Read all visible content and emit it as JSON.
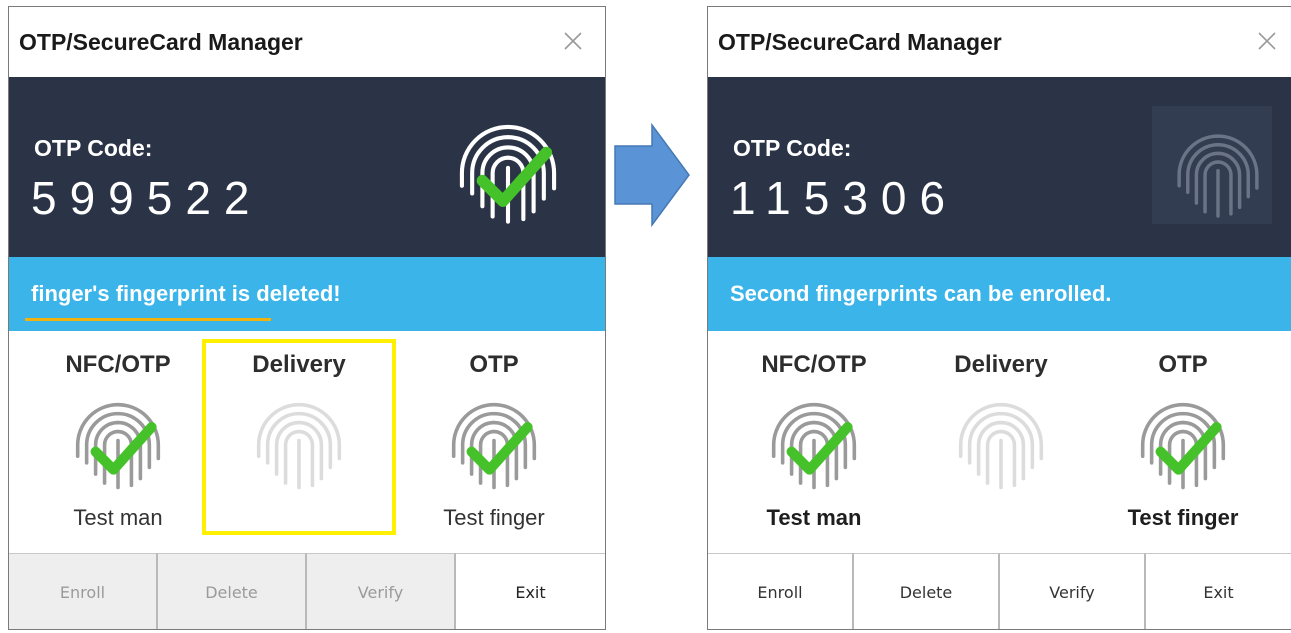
{
  "left_window": {
    "title": "OTP/SecureCard Manager",
    "otp_label": "OTP Code:",
    "otp_code": "599522",
    "status_message": "finger's fingerprint is deleted!",
    "slots": [
      {
        "title": "NFC/OTP",
        "user": "Test man",
        "state": "enrolled-check-icon"
      },
      {
        "title": "Delivery",
        "user": "",
        "state": "empty-fingerprint-icon"
      },
      {
        "title": "OTP",
        "user": "Test finger",
        "state": "enrolled-check-icon"
      }
    ],
    "buttons": {
      "enroll": "Enroll",
      "delete": "Delete",
      "verify": "Verify",
      "exit": "Exit"
    }
  },
  "right_window": {
    "title": "OTP/SecureCard Manager",
    "otp_label": "OTP Code:",
    "otp_code": "115306",
    "status_message": "Second fingerprints can be enrolled.",
    "slots": [
      {
        "title": "NFC/OTP",
        "user": "Test man",
        "state": "enrolled-check-icon"
      },
      {
        "title": "Delivery",
        "user": "",
        "state": "empty-fingerprint-icon"
      },
      {
        "title": "OTP",
        "user": "Test finger",
        "state": "enrolled-check-icon"
      }
    ],
    "buttons": {
      "enroll": "Enroll",
      "delete": "Delete",
      "verify": "Verify",
      "exit": "Exit"
    }
  },
  "colors": {
    "panel_dark": "#2b3447",
    "message_bar": "#3ab4e9",
    "check_green": "#45c22a",
    "highlight_yellow": "#ffef00",
    "underline_orange": "#f2b20c",
    "arrow_blue": "#5b94d6"
  },
  "icons": [
    "close-icon",
    "fingerprint-icon",
    "check-icon",
    "arrow-right-icon"
  ]
}
